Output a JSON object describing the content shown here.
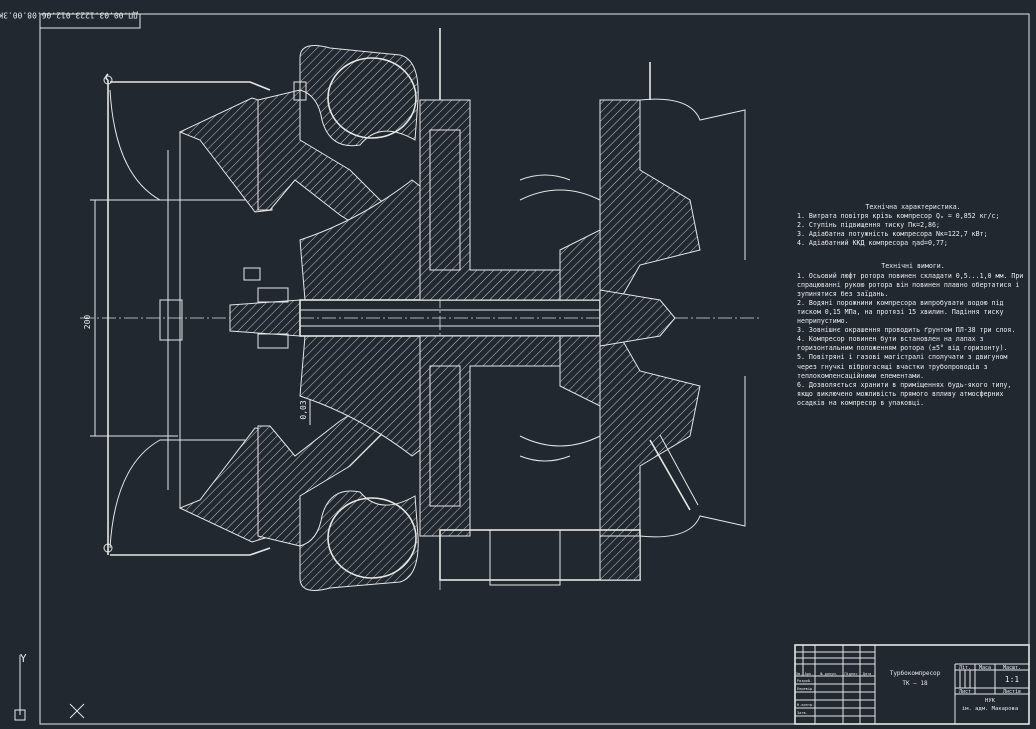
{
  "stamp_code": "ДП.00.03.1223.012.06.08.00.ЗК",
  "dim_diameter": "200",
  "dim_clearance": "0,03",
  "tech_characteristics": {
    "title": "Технічна характеристика.",
    "lines": [
      "1. Витрата повітря крізь компресор Qₐ = 0,852 кг/с;",
      "2. Ступінь підвищення тиску Пк=2,86;",
      "3. Адіабатна потужність компресора Nк=122,7 кВт;",
      "4. Адіабатний ККД компресора ηаd=0,77;"
    ]
  },
  "tech_requirements": {
    "title": "Технічні вимоги.",
    "lines": [
      "1. Осьовий люфт ротора повинен складати 0,5...1,0 мм. При спрацюванні рукою ротора він повинен плавно обертатися і зупинятися без заїдань.",
      "2. Водяні порожнини компресора випробувати водою під тиском 0,15 МПа, на протязі 15 хвилин. Падіння тиску неприпустимо.",
      "3. Зовнішнє окрашення проводить ґрунтом ПЛ-38 три слоя.",
      "4. Компресор повинен бути встановлен на лапах з горизонтальним положенням ротора (±5° від горизонту).",
      "5. Повітряні і газові магістралі сполучати з двигуном через гнучкі віброгасящі вчастки трубопроводів з теплокомпенсаційними елементами.",
      "6. Дозволяється хранити в приміщеннях будь-якого типу, якщо виключено можливість прямого впливу атмосферних осадків на компресор в упаковці."
    ]
  },
  "title_block": {
    "name_line1": "Турбокомпресор",
    "name_line2": "ТК — 18",
    "col_lit": "Літ.",
    "col_mass": "Маса",
    "col_scale": "Масшт.",
    "scale_value": "1:1",
    "sheet_label": "Лист",
    "sheets_label": "Листів",
    "org_line1": "НУК",
    "org_line2": "ім. адм. Макарова",
    "row_headers": [
      "Зм.",
      "Арк.",
      "№ докум.",
      "Підпис",
      "Дата"
    ],
    "roles": [
      "Розроб.",
      "Перевір.",
      "",
      "Н.контр.",
      "Затв."
    ]
  },
  "ucs": {
    "y_label": "Y"
  }
}
